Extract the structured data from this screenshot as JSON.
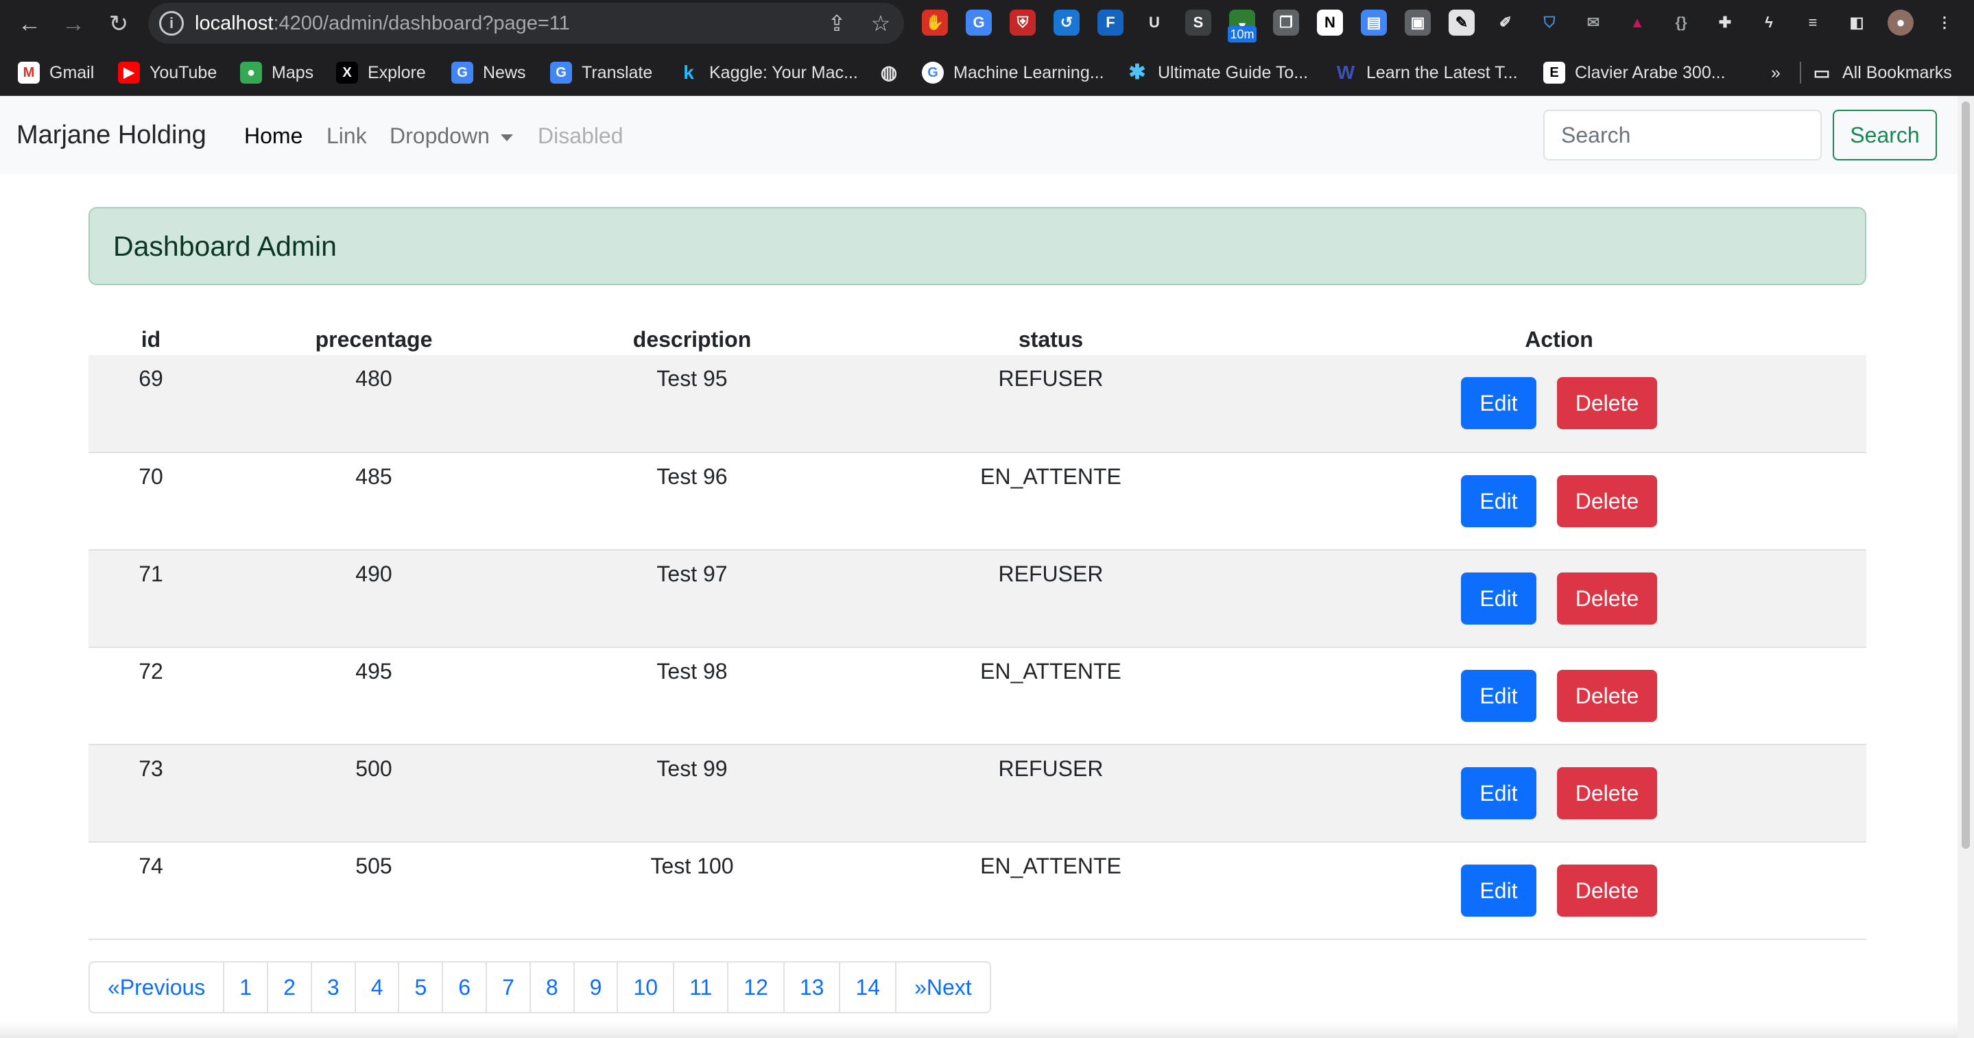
{
  "browser": {
    "url_host": "localhost",
    "url_rest": ":4200/admin/dashboard?page=11",
    "extension_badge": "10m",
    "bookmarks": [
      {
        "label": "Gmail",
        "icon": "gmail-icon",
        "glyph": "M",
        "color": "#d93025"
      },
      {
        "label": "YouTube",
        "icon": "youtube-icon",
        "glyph": "▶",
        "color": "#ff0000"
      },
      {
        "label": "Maps",
        "icon": "maps-icon",
        "glyph": "●",
        "color": "#34a853"
      },
      {
        "label": "Explore",
        "icon": "x-icon",
        "glyph": "X",
        "color": "#000000"
      },
      {
        "label": "News",
        "icon": "news-icon",
        "glyph": "G",
        "color": "#4285f4"
      },
      {
        "label": "Translate",
        "icon": "translate-icon",
        "glyph": "G",
        "color": "#4285f4"
      },
      {
        "label": "Kaggle: Your Mac...",
        "icon": "kaggle-icon",
        "glyph": "k",
        "color": "#1f1f22"
      },
      {
        "label": "",
        "icon": "globe-icon",
        "glyph": "◍",
        "color": "#1f1f22"
      },
      {
        "label": "Machine Learning...",
        "icon": "google-icon",
        "glyph": "G",
        "color": "#ffffff"
      },
      {
        "label": "Ultimate Guide To...",
        "icon": "asterisk-icon",
        "glyph": "✱",
        "color": "#1f1f22"
      },
      {
        "label": "Learn the Latest T...",
        "icon": "w-icon",
        "glyph": "W",
        "color": "#1f1f22"
      },
      {
        "label": "Clavier Arabe 300...",
        "icon": "clavier-icon",
        "glyph": "E",
        "color": "#ffffff"
      }
    ],
    "more_label": "»",
    "all_bookmarks_label": "All Bookmarks"
  },
  "nav": {
    "brand": "Marjane Holding",
    "links": [
      {
        "label": "Home",
        "state": "active"
      },
      {
        "label": "Link",
        "state": "normal"
      },
      {
        "label": "Dropdown",
        "state": "dropdown"
      },
      {
        "label": "Disabled",
        "state": "disabled"
      }
    ],
    "search_placeholder": "Search",
    "search_button": "Search"
  },
  "dashboard": {
    "title": "Dashboard Admin",
    "columns": [
      "id",
      "precentage",
      "description",
      "status",
      "Action"
    ],
    "rows": [
      {
        "id": "69",
        "percentage": "480",
        "description": "Test 95",
        "status": "REFUSER"
      },
      {
        "id": "70",
        "percentage": "485",
        "description": "Test 96",
        "status": "EN_ATTENTE"
      },
      {
        "id": "71",
        "percentage": "490",
        "description": "Test 97",
        "status": "REFUSER"
      },
      {
        "id": "72",
        "percentage": "495",
        "description": "Test 98",
        "status": "EN_ATTENTE"
      },
      {
        "id": "73",
        "percentage": "500",
        "description": "Test 99",
        "status": "REFUSER"
      },
      {
        "id": "74",
        "percentage": "505",
        "description": "Test 100",
        "status": "EN_ATTENTE"
      }
    ],
    "edit_label": "Edit",
    "delete_label": "Delete"
  },
  "pagination": {
    "previous": "«Previous",
    "pages": [
      "1",
      "2",
      "3",
      "4",
      "5",
      "6",
      "7",
      "8",
      "9",
      "10",
      "11",
      "12",
      "13",
      "14"
    ],
    "next": "»Next"
  }
}
